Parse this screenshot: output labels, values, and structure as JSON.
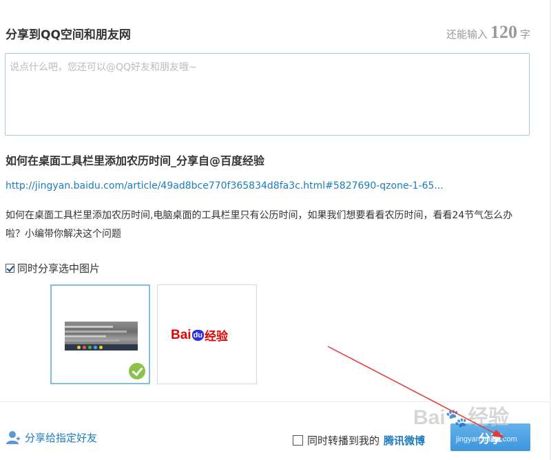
{
  "header": {
    "title": "分享到QQ空间和朋友网",
    "counter_prefix": "还能输入",
    "counter_value": "120",
    "counter_suffix": "字"
  },
  "comment": {
    "placeholder": "说点什么吧，您还可以@QQ好友和朋友哦~",
    "value": ""
  },
  "article": {
    "title": "如何在桌面工具栏里添加农历时间_分享自@百度经验",
    "url": "http://jingyan.baidu.com/article/49ad8bce770f365834d8fa3c.html#5827690-qzone-1-65...",
    "description": "如何在桌面工具栏里添加农历时间,电脑桌面的工具栏里只有公历时间，如果我们想要看看农历时间，看看24节气怎么办啦？小编带你解决这个问题"
  },
  "share_images": {
    "label": "同时分享选中图片",
    "checked": true,
    "thumbnails": [
      {
        "name": "screenshot-thumbnail",
        "selected": true
      },
      {
        "name": "baidu-jingyan-logo",
        "selected": false,
        "logo_text_bai": "Bai",
        "logo_text_du": "du",
        "logo_text_jy": "经验"
      }
    ]
  },
  "footer": {
    "share_friend_label": "分享给指定好友",
    "forward_label": "同时转播到我的",
    "forward_link": "腾讯微博",
    "forward_checked": false,
    "share_button_label": "分享"
  },
  "watermark": {
    "text": "Bai 经验",
    "sub": "jingyan.baidu.com"
  },
  "colors": {
    "link": "#1a7bbf",
    "button": "#4aa3e6",
    "annotation_arrow": "#e53935"
  }
}
